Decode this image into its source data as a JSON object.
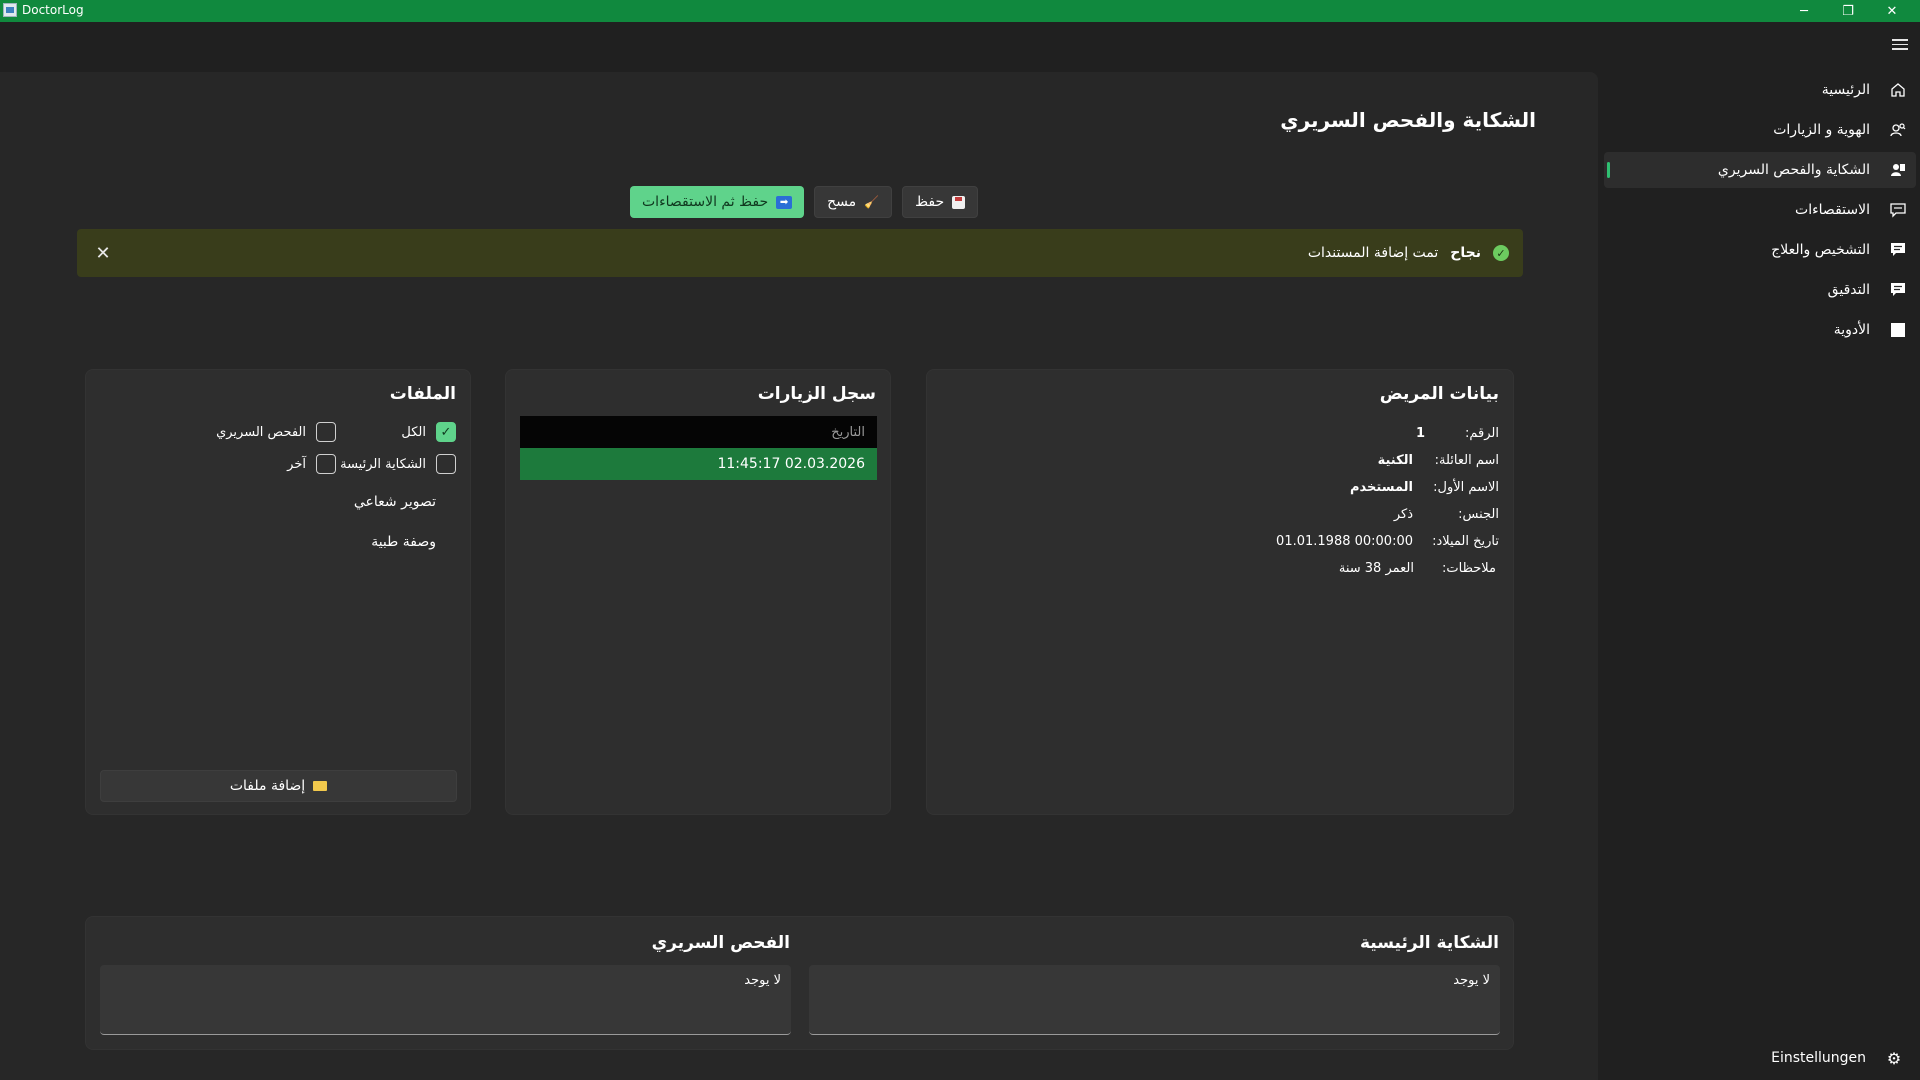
{
  "window": {
    "app_title": "DoctorLog",
    "minimize": "─",
    "restore": "❐",
    "close": "✕"
  },
  "nav": {
    "items": [
      {
        "label": "الرئيسية",
        "icon": "home-icon"
      },
      {
        "label": "الهوية و الزيارات",
        "icon": "person-search-icon"
      },
      {
        "label": "الشكاية والفحص السريري",
        "icon": "person-card-icon"
      },
      {
        "label": "الاستقصاءات",
        "icon": "chat-icon"
      },
      {
        "label": "التشخيص والعلاج",
        "icon": "message-icon"
      },
      {
        "label": "التدقيق",
        "icon": "message-icon"
      },
      {
        "label": "الأدوية",
        "icon": "square-icon"
      }
    ],
    "active_index": 2,
    "settings_label": "Einstellungen"
  },
  "page": {
    "title": "الشكاية والفحص السريري"
  },
  "toolbar": {
    "save_label": "حفظ",
    "clear_label": "مسح",
    "save_then_label": "حفظ ثم الاستقصاءات"
  },
  "infobar": {
    "title": "نجاح",
    "message": "تمت إضافة المستندات"
  },
  "patient": {
    "title": "بيانات المريض",
    "rows": [
      {
        "label": "الرقم:",
        "value": "1"
      },
      {
        "label": "اسم العائلة:",
        "value": "الكنية"
      },
      {
        "label": "الاسم الأول:",
        "value": "المستخدم"
      },
      {
        "label": "الجنس:",
        "value": "ذكر"
      },
      {
        "label": "تاريخ الميلاد:",
        "value": "01.01.1988 00:00:00"
      },
      {
        "label": "ملاحظات:",
        "value": "العمر 38 سنة"
      }
    ]
  },
  "visits": {
    "title": "سجل الزيارات",
    "column_header": "التاريخ",
    "rows": [
      "02.03.2026 11:45:17"
    ]
  },
  "files": {
    "title": "الملفات",
    "filters": [
      {
        "label": "الكل",
        "checked": true
      },
      {
        "label": "الفحص السريري",
        "checked": false
      },
      {
        "label": "الشكاية الرئيسة",
        "checked": false
      },
      {
        "label": "آخر",
        "checked": false
      }
    ],
    "items": [
      "تصوير شعاعي",
      "وصفة طبية"
    ],
    "add_label": "إضافة ملفات"
  },
  "complaint": {
    "title": "الشكاية الرئيسية",
    "value": "لا يوجد"
  },
  "exam": {
    "title": "الفحص السريري",
    "value": "لا يوجد"
  },
  "colors": {
    "titlebar": "#10893e",
    "accent": "#5fd38b",
    "selected_row": "#1d7a3c",
    "success_bar": "#393d1b"
  }
}
